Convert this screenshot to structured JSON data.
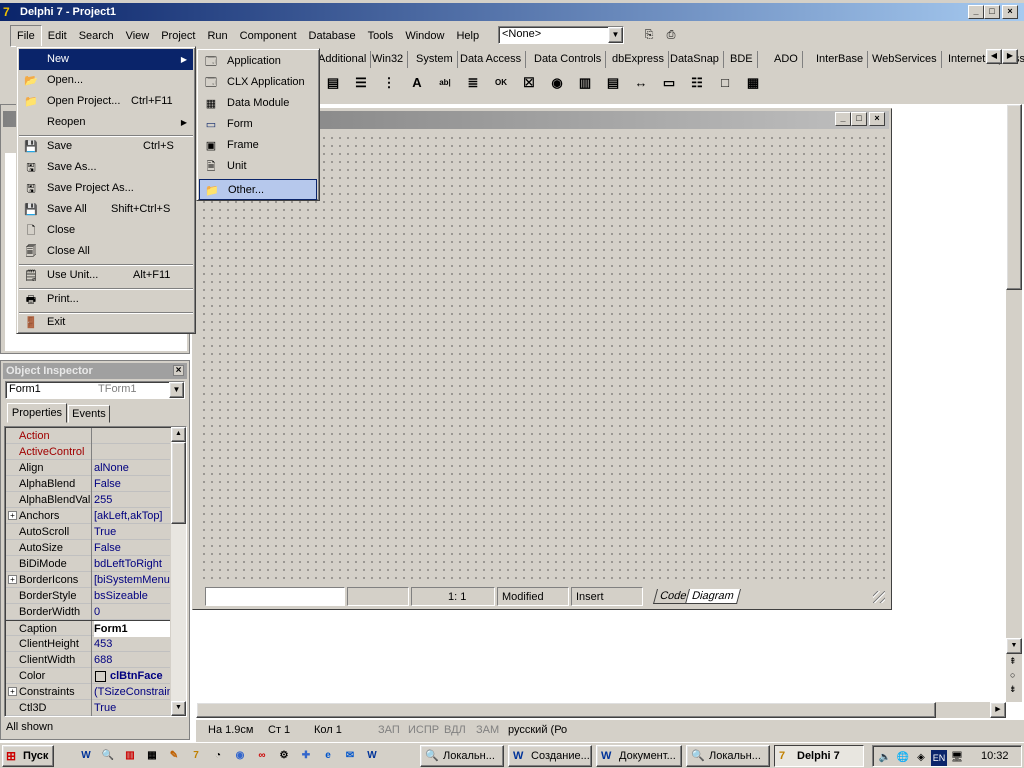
{
  "app": {
    "title": "Delphi 7 - Project1"
  },
  "menubar": [
    "File",
    "Edit",
    "Search",
    "View",
    "Project",
    "Run",
    "Component",
    "Database",
    "Tools",
    "Window",
    "Help"
  ],
  "toolbar": {
    "combo_value": "<None>"
  },
  "palette": {
    "tabs": [
      "Additional",
      "Win32",
      "System",
      "Data Access",
      "Data Controls",
      "dbExpress",
      "DataSnap",
      "BDE",
      "ADO",
      "InterBase",
      "WebServices",
      "InternetExpress"
    ],
    "tools": [
      {
        "icon": "frame-icon",
        "glyph": "▤"
      },
      {
        "icon": "mainmenu-icon",
        "glyph": "☰"
      },
      {
        "icon": "popupmenu-icon",
        "glyph": "⋮"
      },
      {
        "icon": "label-icon",
        "glyph": "A"
      },
      {
        "icon": "edit-icon",
        "glyph": "ab|"
      },
      {
        "icon": "memo-icon",
        "glyph": "≣"
      },
      {
        "icon": "button-icon",
        "glyph": "OK"
      },
      {
        "icon": "checkbox-icon",
        "glyph": "☒"
      },
      {
        "icon": "radiobutton-icon",
        "glyph": "◉"
      },
      {
        "icon": "listbox-icon",
        "glyph": "▥"
      },
      {
        "icon": "combobox-icon",
        "glyph": "▤"
      },
      {
        "icon": "scrollbar-icon",
        "glyph": "↔"
      },
      {
        "icon": "groupbox-icon",
        "glyph": "▭"
      },
      {
        "icon": "radiogroup-icon",
        "glyph": "☷"
      },
      {
        "icon": "panel-icon",
        "glyph": "□"
      },
      {
        "icon": "actionlist-icon",
        "glyph": "▦"
      }
    ]
  },
  "file_menu": {
    "items": [
      {
        "label": "New",
        "shortcut": "",
        "icon": "",
        "submenu": true
      },
      {
        "label": "Open...",
        "shortcut": "",
        "icon": "open-icon"
      },
      {
        "label": "Open Project...",
        "shortcut": "Ctrl+F11",
        "icon": "open-project-icon"
      },
      {
        "label": "Reopen",
        "shortcut": "",
        "icon": "",
        "submenu": true
      },
      {
        "label": "Save",
        "shortcut": "Ctrl+S",
        "icon": "save-icon"
      },
      {
        "label": "Save As...",
        "shortcut": "",
        "icon": "save-as-icon"
      },
      {
        "label": "Save Project As...",
        "shortcut": "",
        "icon": "save-project-icon"
      },
      {
        "label": "Save All",
        "shortcut": "Shift+Ctrl+S",
        "icon": "save-all-icon"
      },
      {
        "label": "Close",
        "shortcut": "",
        "icon": "close-file-icon"
      },
      {
        "label": "Close All",
        "shortcut": "",
        "icon": "close-all-icon"
      },
      {
        "label": "Use Unit...",
        "shortcut": "Alt+F11",
        "icon": "use-unit-icon"
      },
      {
        "label": "Print...",
        "shortcut": "",
        "icon": "print-icon"
      },
      {
        "label": "Exit",
        "shortcut": "",
        "icon": "exit-icon"
      }
    ]
  },
  "new_submenu": {
    "items": [
      "Application",
      "CLX Application",
      "Data Module",
      "Form",
      "Frame",
      "Unit",
      "Other..."
    ]
  },
  "object_inspector": {
    "title": "Object Inspector",
    "selected_object": "Form1",
    "selected_type": "TForm1",
    "tabs": [
      "Properties",
      "Events"
    ],
    "footer": "All shown",
    "properties": [
      {
        "name": "Action",
        "value": "",
        "red": true
      },
      {
        "name": "ActiveControl",
        "value": "",
        "red": true
      },
      {
        "name": "Align",
        "value": "alNone"
      },
      {
        "name": "AlphaBlend",
        "value": "False"
      },
      {
        "name": "AlphaBlendVal",
        "value": "255"
      },
      {
        "name": "Anchors",
        "value": "[akLeft,akTop]",
        "expand": true
      },
      {
        "name": "AutoScroll",
        "value": "True"
      },
      {
        "name": "AutoSize",
        "value": "False"
      },
      {
        "name": "BiDiMode",
        "value": "bdLeftToRight"
      },
      {
        "name": "BorderIcons",
        "value": "[biSystemMenu,",
        "expand": true
      },
      {
        "name": "BorderStyle",
        "value": "bsSizeable"
      },
      {
        "name": "BorderWidth",
        "value": "0"
      },
      {
        "name": "Caption",
        "value": "Form1",
        "selected": true
      },
      {
        "name": "ClientHeight",
        "value": "453"
      },
      {
        "name": "ClientWidth",
        "value": "688"
      },
      {
        "name": "Color",
        "value": "clBtnFace",
        "swatch": true
      },
      {
        "name": "Constraints",
        "value": "(TSizeConstraint",
        "expand": true
      },
      {
        "name": "Ctl3D",
        "value": "True"
      }
    ]
  },
  "editor_status": {
    "position": "1:   1",
    "modified": "Modified",
    "mode": "Insert",
    "tab_code": "Code",
    "tab_diagram": "Diagram"
  },
  "word_status": {
    "page": "На 1.9см",
    "line": "Ст 1",
    "col": "Кол 1",
    "rec": "ЗАП",
    "trk": "ИСПР",
    "ext": "ВДЛ",
    "ovr": "ЗАМ",
    "lang": "русский (Ро"
  },
  "taskbar": {
    "start_label": "Пуск",
    "tasks": [
      "Локальн...",
      "Создание...",
      "Документ...",
      "Локальн...",
      "Delphi 7"
    ],
    "lang": "EN",
    "clock": "10:32"
  }
}
